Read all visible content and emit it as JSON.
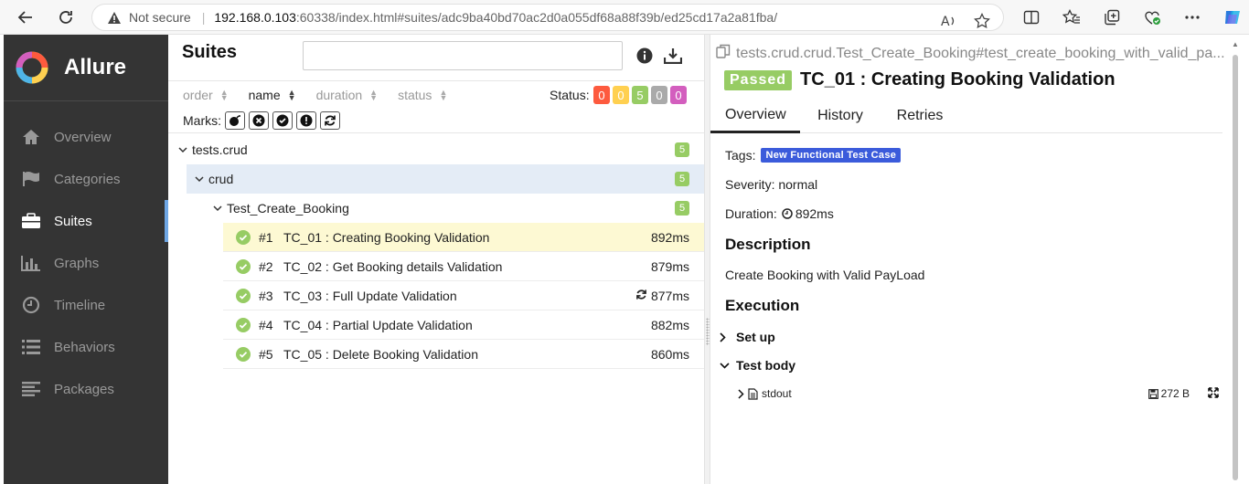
{
  "browser": {
    "security": "Not secure",
    "url_host": "192.168.0.103",
    "url_path": ":60338/index.html#suites/adc9ba40bd70ac2d0a055df68a88f39b/ed25cd17a2a81fba/"
  },
  "app": {
    "brand": "Allure",
    "nav": [
      {
        "label": "Overview",
        "icon": "home-icon",
        "active": false
      },
      {
        "label": "Categories",
        "icon": "flag-icon",
        "active": false
      },
      {
        "label": "Suites",
        "icon": "briefcase-icon",
        "active": true
      },
      {
        "label": "Graphs",
        "icon": "bar-chart-icon",
        "active": false
      },
      {
        "label": "Timeline",
        "icon": "clock-icon",
        "active": false
      },
      {
        "label": "Behaviors",
        "icon": "list-icon",
        "active": false
      },
      {
        "label": "Packages",
        "icon": "align-left-icon",
        "active": false
      }
    ]
  },
  "suites": {
    "title": "Suites",
    "search_placeholder": "",
    "sort": [
      "order",
      "name",
      "duration",
      "status"
    ],
    "status_label": "Status:",
    "status_counts": [
      {
        "value": "0",
        "color": "#fd5a3e"
      },
      {
        "value": "0",
        "color": "#ffd050"
      },
      {
        "value": "5",
        "color": "#97cc64"
      },
      {
        "value": "0",
        "color": "#aaaaaa"
      },
      {
        "value": "0",
        "color": "#d35ebe"
      }
    ],
    "marks_label": "Marks:",
    "tree": {
      "root": {
        "label": "tests.crud",
        "count": "5"
      },
      "child": {
        "label": "crud",
        "count": "5"
      },
      "grandchild": {
        "label": "Test_Create_Booking",
        "count": "5"
      }
    },
    "cases": [
      {
        "num": "#1",
        "name": "TC_01 : Creating Booking Validation",
        "duration": "892ms",
        "retried": false
      },
      {
        "num": "#2",
        "name": "TC_02 : Get Booking details Validation",
        "duration": "879ms",
        "retried": false
      },
      {
        "num": "#3",
        "name": "TC_03 : Full Update Validation",
        "duration": "877ms",
        "retried": true
      },
      {
        "num": "#4",
        "name": "TC_04 : Partial Update Validation",
        "duration": "882ms",
        "retried": false
      },
      {
        "num": "#5",
        "name": "TC_05 : Delete Booking Validation",
        "duration": "860ms",
        "retried": false
      }
    ]
  },
  "detail": {
    "breadcrumb": "tests.crud.crud.Test_Create_Booking#test_create_booking_with_valid_pa...",
    "status": "Passed",
    "title": "TC_01 : Creating Booking Validation",
    "tabs": [
      "Overview",
      "History",
      "Retries"
    ],
    "tags_label": "Tags:",
    "tag": "New Functional Test Case",
    "severity": "Severity: normal",
    "duration_label": "Duration:",
    "duration": "892ms",
    "description_heading": "Description",
    "description": "Create Booking with Valid PayLoad",
    "execution_heading": "Execution",
    "setup": "Set up",
    "test_body": "Test body",
    "attachment": "stdout",
    "attachment_size": "272 B"
  }
}
